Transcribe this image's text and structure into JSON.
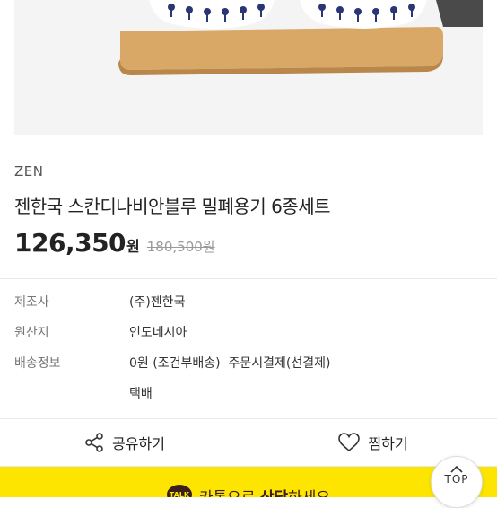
{
  "product": {
    "brand": "ZEN",
    "title": "젠한국 스칸디나비안블루 밀폐용기 6종세트",
    "price": "126,350",
    "price_unit": "원",
    "original_price": "180,500원"
  },
  "info": {
    "manufacturer_label": "제조사",
    "manufacturer_value": "(주)젠한국",
    "origin_label": "원산지",
    "origin_value": "인도네시아",
    "shipping_label": "배송정보",
    "shipping_value": "0원 (조건부배송)  주문시결제(선결제)",
    "shipping_method": "택배"
  },
  "actions": {
    "share_label": "공유하기",
    "wish_label": "찜하기"
  },
  "kakao": {
    "badge": "TALK",
    "text_prefix": "카톡으로 ",
    "text_bold": "상담",
    "text_suffix": "하세요"
  },
  "top_button": {
    "label": "TOP"
  }
}
